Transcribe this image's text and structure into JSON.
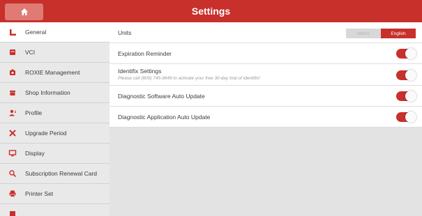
{
  "header": {
    "title": "Settings",
    "home_icon": "home-icon"
  },
  "accent_color": "#c8302b",
  "sidebar": {
    "items": [
      {
        "label": "General",
        "icon": "general-icon",
        "active": true
      },
      {
        "label": "VCI",
        "icon": "vci-icon"
      },
      {
        "label": "ROXIE Management",
        "icon": "roxie-icon"
      },
      {
        "label": "Shop Information",
        "icon": "shop-icon"
      },
      {
        "label": "Profile",
        "icon": "profile-icon"
      },
      {
        "label": "Upgrade Period",
        "icon": "wrench-icon"
      },
      {
        "label": "Display",
        "icon": "display-icon"
      },
      {
        "label": "Subscription Renewal Card",
        "icon": "search-icon"
      },
      {
        "label": "Printer Set",
        "icon": "printer-icon"
      }
    ]
  },
  "settings": {
    "units": {
      "label": "Units",
      "options": [
        "Metric",
        "English"
      ],
      "selected": "English"
    },
    "expiration_reminder": {
      "label": "Expiration Reminder",
      "on": true
    },
    "identifix": {
      "label": "Identifix Settings",
      "note": "Please call (800) 745-9649 to activate your free 30-day trial of Identifix!",
      "on": true
    },
    "software_update": {
      "label": "Diagnostic Software Auto Update",
      "on": true
    },
    "app_update": {
      "label": "Diagnostic Application Auto Update",
      "on": true
    }
  }
}
